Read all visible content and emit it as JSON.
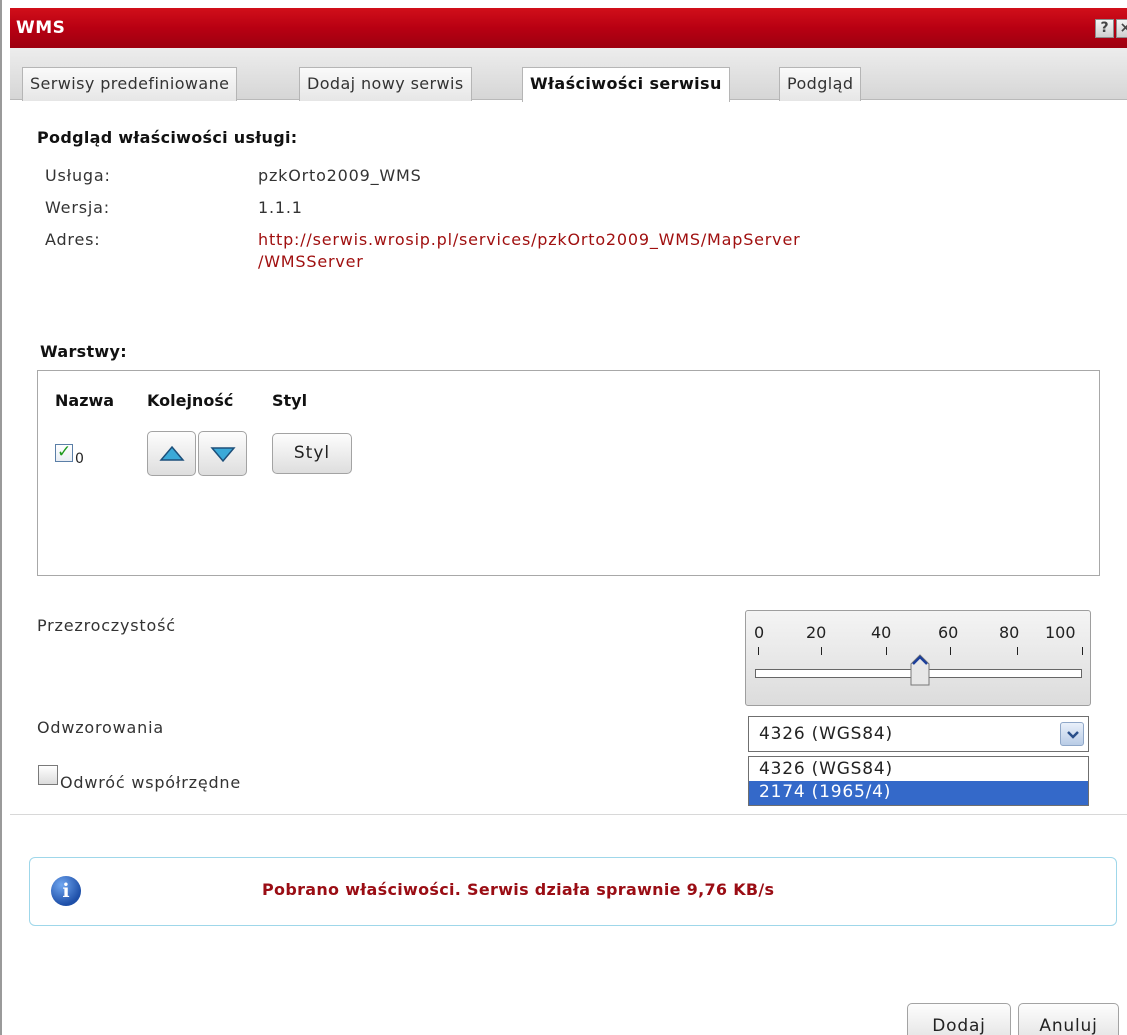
{
  "window": {
    "title": "WMS",
    "help_icon": "?",
    "close_icon": "×"
  },
  "tabs": [
    {
      "label": "Serwisy predefiniowane",
      "active": false
    },
    {
      "label": "Dodaj nowy serwis",
      "active": false
    },
    {
      "label": "Właściwości serwisu",
      "active": true
    },
    {
      "label": "Podgląd",
      "active": false
    }
  ],
  "properties": {
    "heading": "Podgląd właściwości usługi:",
    "service_label": "Usługa:",
    "service_value": "pzkOrto2009_WMS",
    "version_label": "Wersja:",
    "version_value": "1.1.1",
    "address_label": "Adres:",
    "address_line1": "http://serwis.wrosip.pl/services/pzkOrto2009_WMS/MapServer",
    "address_line2": "/WMSServer"
  },
  "layers": {
    "heading": "Warstwy:",
    "columns": {
      "name": "Nazwa",
      "order": "Kolejność",
      "style": "Styl"
    },
    "rows": [
      {
        "name": "0",
        "checked": true,
        "style_button": "Styl"
      }
    ]
  },
  "transparency": {
    "label": "Przezroczystość",
    "ticks": [
      "0",
      "20",
      "40",
      "60",
      "80",
      "100"
    ],
    "value_percent": 50
  },
  "projection": {
    "label": "Odwzorowania",
    "selected": "4326 (WGS84)",
    "options": [
      {
        "label": "4326 (WGS84)",
        "highlighted": false
      },
      {
        "label": "2174 (1965/4)",
        "highlighted": true
      }
    ]
  },
  "swap_coords": {
    "label": "Odwróć współrzędne",
    "checked": false
  },
  "info": {
    "icon": "i",
    "message": "Pobrano właściwości. Serwis działa sprawnie 9,76 KB/s"
  },
  "footer": {
    "add_label": "Dodaj",
    "cancel_label": "Anuluj"
  }
}
